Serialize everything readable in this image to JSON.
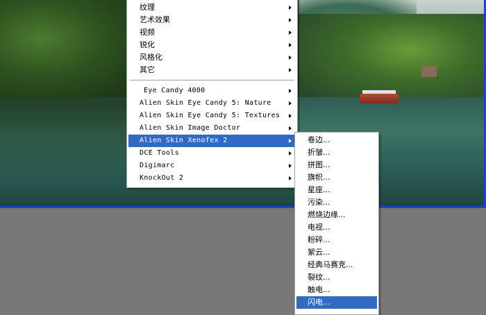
{
  "main_menu": {
    "items": [
      {
        "label": "纹理",
        "has_submenu": true
      },
      {
        "label": "艺术效果",
        "has_submenu": true
      },
      {
        "label": "视频",
        "has_submenu": true
      },
      {
        "label": "锐化",
        "has_submenu": true
      },
      {
        "label": "风格化",
        "has_submenu": true
      },
      {
        "label": "其它",
        "has_submenu": true
      }
    ],
    "plugins": [
      {
        "label": "Eye Candy 4000",
        "has_submenu": true
      },
      {
        "label": "Alien Skin Eye Candy 5: Nature",
        "has_submenu": true
      },
      {
        "label": "Alien Skin Eye Candy 5: Textures",
        "has_submenu": true
      },
      {
        "label": "Alien Skin Image Doctor",
        "has_submenu": true
      },
      {
        "label": "Alien Skin Xenofex 2",
        "has_submenu": true,
        "highlighted": true
      },
      {
        "label": "DCE Tools",
        "has_submenu": true
      },
      {
        "label": "Digimarc",
        "has_submenu": true
      },
      {
        "label": "KnockOut 2",
        "has_submenu": true
      }
    ]
  },
  "sub_menu": {
    "items": [
      {
        "label": "卷边..."
      },
      {
        "label": "折皱..."
      },
      {
        "label": "拼图..."
      },
      {
        "label": "旗帜..."
      },
      {
        "label": "星座..."
      },
      {
        "label": "污染..."
      },
      {
        "label": "燃烧边缘..."
      },
      {
        "label": "电视..."
      },
      {
        "label": "粉碎..."
      },
      {
        "label": "絮云..."
      },
      {
        "label": "经典马赛克..."
      },
      {
        "label": "裂纹..."
      },
      {
        "label": "触电..."
      },
      {
        "label": "闪电...",
        "highlighted": true
      }
    ]
  },
  "colors": {
    "highlight": "#316ac5",
    "frame_border": "#1e43c8",
    "workspace": "#787878"
  }
}
